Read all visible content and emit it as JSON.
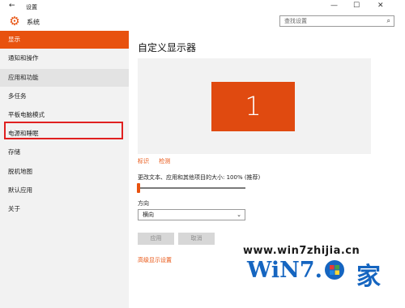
{
  "window": {
    "title": "设置",
    "back_glyph": "←",
    "minimize_glyph": "—",
    "maximize_glyph": "☐",
    "close_glyph": "✕"
  },
  "header": {
    "section_title": "系统",
    "icon": "gear-icon"
  },
  "search": {
    "placeholder": "查找设置",
    "icon": "search-icon"
  },
  "sidebar": {
    "items": [
      {
        "label": "显示",
        "state": "selected"
      },
      {
        "label": "通知和操作"
      },
      {
        "label": "应用和功能",
        "state": "hover"
      },
      {
        "label": "多任务"
      },
      {
        "label": "平板电脑模式"
      },
      {
        "label": "电源和睡眠",
        "highlighted": true
      },
      {
        "label": "存储"
      },
      {
        "label": "脱机地图"
      },
      {
        "label": "默认应用"
      },
      {
        "label": "关于"
      }
    ]
  },
  "main": {
    "title": "自定义显示器",
    "monitor_number": "1",
    "identify_link": "标识",
    "detect_link": "检测",
    "scale_label": "更改文本、应用和其他项目的大小: 100% (推荐)",
    "scale_value_percent": 100,
    "orientation_label": "方向",
    "orientation_value": "横向",
    "apply_button": "应用",
    "cancel_button": "取消",
    "advanced_link": "高级显示设置"
  },
  "watermark": {
    "site": "www.win7zhijia.cn",
    "logo_text": "WiN7.",
    "logo_char": "家"
  },
  "colors": {
    "accent": "#e8520f",
    "sidebar_bg": "#f2f2f2",
    "highlight_box": "#e02020"
  }
}
